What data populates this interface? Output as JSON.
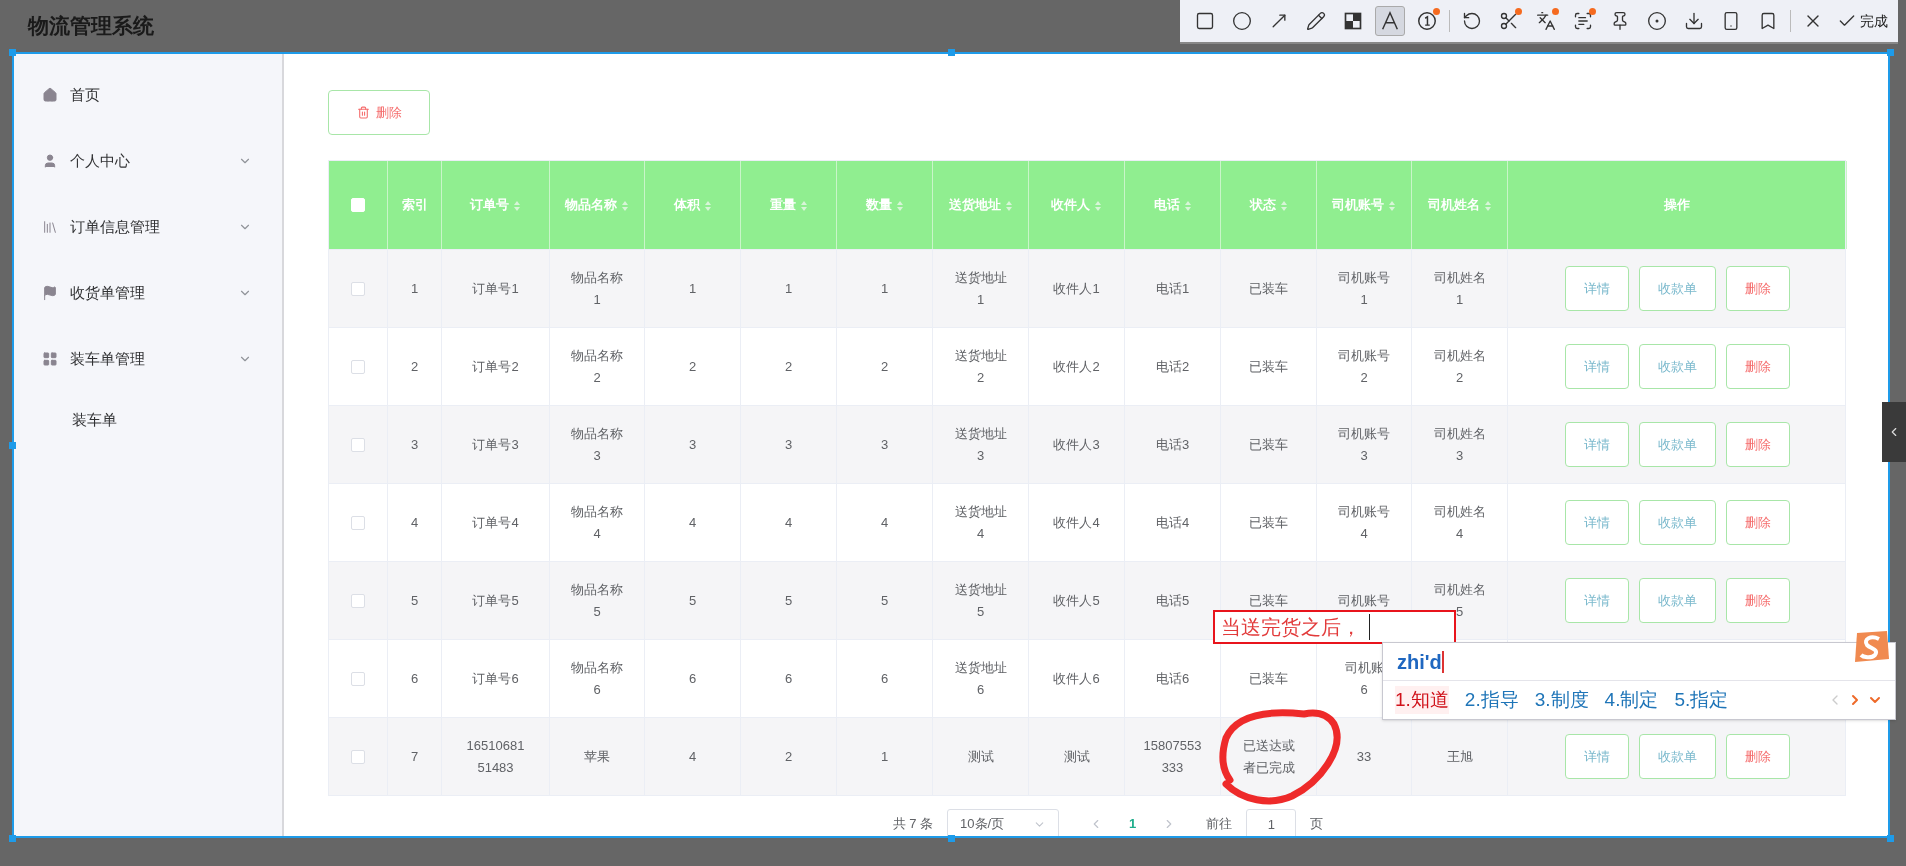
{
  "app_title": "物流管理系统",
  "screenshot_toolbar": {
    "tools": [
      {
        "kind": "rectangle",
        "selected": false,
        "dot": false
      },
      {
        "kind": "ellipse",
        "selected": false,
        "dot": false
      },
      {
        "kind": "arrow",
        "selected": false,
        "dot": false
      },
      {
        "kind": "pencil",
        "selected": false,
        "dot": false
      },
      {
        "kind": "mosaic",
        "selected": false,
        "dot": false
      },
      {
        "kind": "text",
        "selected": true,
        "dot": false
      },
      {
        "kind": "number",
        "selected": false,
        "dot": true
      },
      {
        "kind": "undo",
        "selected": false,
        "dot": false
      },
      {
        "kind": "scissors",
        "selected": false,
        "dot": true
      },
      {
        "kind": "translate",
        "selected": false,
        "dot": true
      },
      {
        "kind": "ocr",
        "selected": false,
        "dot": true
      },
      {
        "kind": "pin",
        "selected": false,
        "dot": false
      },
      {
        "kind": "record",
        "selected": false,
        "dot": false
      },
      {
        "kind": "download",
        "selected": false,
        "dot": false
      },
      {
        "kind": "phone",
        "selected": false,
        "dot": false
      },
      {
        "kind": "bookmark",
        "selected": false,
        "dot": false
      },
      {
        "kind": "close",
        "selected": false,
        "dot": false
      }
    ],
    "done_label": "完成"
  },
  "sidebar": {
    "items": [
      {
        "label": "首页",
        "kind": "home",
        "submenu": false
      },
      {
        "label": "个人中心",
        "kind": "user",
        "submenu": true
      },
      {
        "label": "订单信息管理",
        "kind": "books",
        "submenu": true
      },
      {
        "label": "收货单管理",
        "kind": "flag",
        "submenu": true
      },
      {
        "label": "装车单管理",
        "kind": "grid",
        "submenu": true,
        "children": [
          {
            "label": "装车单"
          }
        ]
      }
    ]
  },
  "delete_button": "删除",
  "table": {
    "header_checked": false,
    "columns": [
      {
        "label": "索引",
        "sortable": false
      },
      {
        "label": "订单号",
        "sortable": true
      },
      {
        "label": "物品名称",
        "sortable": true
      },
      {
        "label": "体积",
        "sortable": true
      },
      {
        "label": "重量",
        "sortable": true
      },
      {
        "label": "数量",
        "sortable": true
      },
      {
        "label": "送货地址",
        "sortable": true
      },
      {
        "label": "收件人",
        "sortable": true
      },
      {
        "label": "电话",
        "sortable": true
      },
      {
        "label": "状态",
        "sortable": true
      },
      {
        "label": "司机账号",
        "sortable": true
      },
      {
        "label": "司机姓名",
        "sortable": true
      },
      {
        "label": "操作",
        "sortable": false
      }
    ],
    "rows": [
      {
        "checked": false,
        "cells": [
          "1",
          "订单号1",
          "物品名称1",
          "1",
          "1",
          "1",
          "送货地址1",
          "收件人1",
          "电话1",
          "已装车",
          "司机账号1",
          "司机姓名1"
        ],
        "actions": [
          {
            "kind": "info",
            "label": "详情"
          },
          {
            "kind": "info",
            "label": "收款单"
          },
          {
            "kind": "danger",
            "label": "删除"
          }
        ]
      },
      {
        "checked": false,
        "cells": [
          "2",
          "订单号2",
          "物品名称2",
          "2",
          "2",
          "2",
          "送货地址2",
          "收件人2",
          "电话2",
          "已装车",
          "司机账号2",
          "司机姓名2"
        ],
        "actions": [
          {
            "kind": "info",
            "label": "详情"
          },
          {
            "kind": "info",
            "label": "收款单"
          },
          {
            "kind": "danger",
            "label": "删除"
          }
        ]
      },
      {
        "checked": false,
        "cells": [
          "3",
          "订单号3",
          "物品名称3",
          "3",
          "3",
          "3",
          "送货地址3",
          "收件人3",
          "电话3",
          "已装车",
          "司机账号3",
          "司机姓名3"
        ],
        "actions": [
          {
            "kind": "info",
            "label": "详情"
          },
          {
            "kind": "info",
            "label": "收款单"
          },
          {
            "kind": "danger",
            "label": "删除"
          }
        ]
      },
      {
        "checked": false,
        "cells": [
          "4",
          "订单号4",
          "物品名称4",
          "4",
          "4",
          "4",
          "送货地址4",
          "收件人4",
          "电话4",
          "已装车",
          "司机账号4",
          "司机姓名4"
        ],
        "actions": [
          {
            "kind": "info",
            "label": "详情"
          },
          {
            "kind": "info",
            "label": "收款单"
          },
          {
            "kind": "danger",
            "label": "删除"
          }
        ]
      },
      {
        "checked": false,
        "cells": [
          "5",
          "订单号5",
          "物品名称5",
          "5",
          "5",
          "5",
          "送货地址5",
          "收件人5",
          "电话5",
          "已装车",
          "司机账号",
          "司机姓名5"
        ],
        "actions": [
          {
            "kind": "info",
            "label": "详情"
          },
          {
            "kind": "info",
            "label": "收款单"
          },
          {
            "kind": "danger",
            "label": "删除"
          }
        ]
      },
      {
        "checked": false,
        "cells": [
          "6",
          "订单号6",
          "物品名称6",
          "6",
          "6",
          "6",
          "送货地址6",
          "收件人6",
          "电话6",
          "已装车",
          "司机账\n6"
        ]
      },
      {
        "checked": false,
        "cells": [
          "7",
          "1651068151483",
          "苹果",
          "4",
          "2",
          "1",
          "测试",
          "测试",
          "15807553333",
          "已送达或者已完成",
          "33",
          "王旭"
        ],
        "actions": [
          {
            "kind": "info",
            "label": "详情"
          },
          {
            "kind": "info",
            "label": "收款单"
          },
          {
            "kind": "danger",
            "label": "删除"
          }
        ]
      }
    ]
  },
  "pagination": {
    "total": "共 7 条",
    "page_size": "10条/页",
    "pages": [
      {
        "label": "1",
        "selected": true
      }
    ],
    "goto_label": "前往",
    "goto_value": "1",
    "goto_suffix": "页"
  },
  "annotation": {
    "text": "当送完货之后，"
  },
  "ime": {
    "input": "zhi'd",
    "candidates": [
      {
        "label": "1.知道",
        "selected": true
      },
      {
        "label": "2.指导",
        "selected": false
      },
      {
        "label": "3.制度",
        "selected": false
      },
      {
        "label": "4.制定",
        "selected": false
      },
      {
        "label": "5.指定",
        "selected": false
      }
    ]
  }
}
